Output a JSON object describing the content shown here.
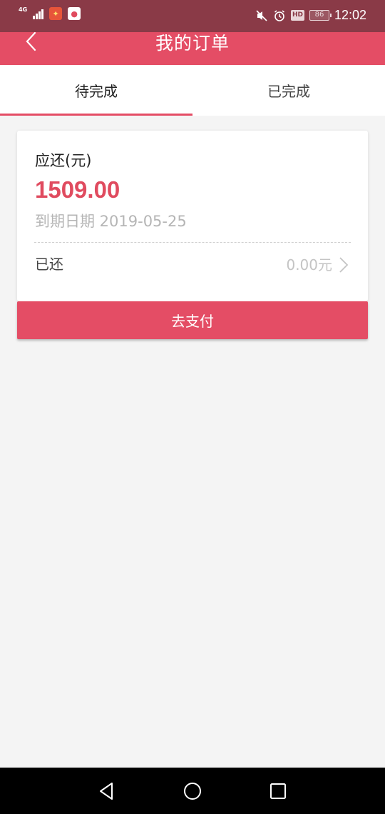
{
  "status_bar": {
    "network": "4G",
    "battery": "86",
    "time": "12:02",
    "hd": "HD",
    "icons": [
      "signal-icon",
      "app-icon",
      "app-icon",
      "mute-icon",
      "alarm-icon",
      "battery-icon"
    ]
  },
  "header": {
    "title": "我的订单",
    "back_icon": "chevron-left-icon"
  },
  "tabs": [
    {
      "label": "待完成",
      "active": true
    },
    {
      "label": "已完成",
      "active": false
    }
  ],
  "order": {
    "due_label": "应还(元)",
    "due_amount": "1509.00",
    "due_date": "到期日期 2019-05-25",
    "repaid_label": "已还",
    "repaid_amount": "0.00元"
  },
  "pay_button": "去支付",
  "colors": {
    "accent": "#e44d65",
    "amount": "#e04b5f",
    "status_bar": "#8a3a47",
    "background": "#f4f4f4"
  },
  "nav_bar": {
    "icons": [
      "triangle-back-icon",
      "circle-home-icon",
      "square-recent-icon"
    ]
  }
}
